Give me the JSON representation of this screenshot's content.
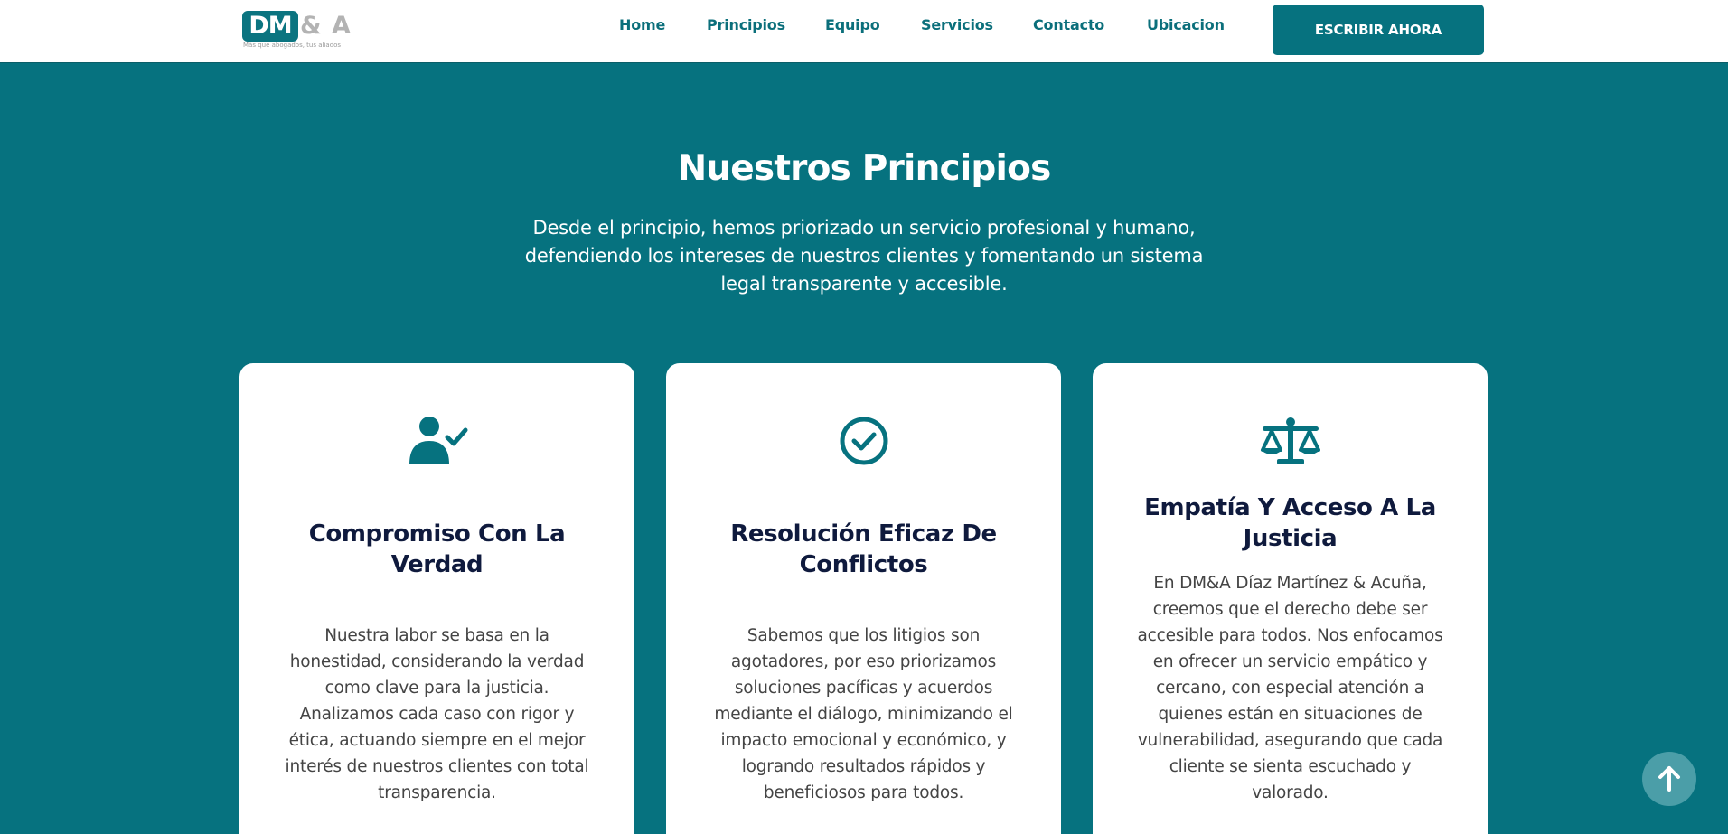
{
  "header": {
    "logo": {
      "mark": "DM",
      "amp": "& A",
      "tagline": "Más que abogados, tus aliados"
    },
    "nav": [
      "Home",
      "Principios",
      "Equipo",
      "Servicios",
      "Contacto",
      "Ubicacion"
    ],
    "cta_label": "ESCRIBIR AHORA"
  },
  "section": {
    "title": "Nuestros Principios",
    "intro": "Desde el principio, hemos priorizado un servicio profesional y humano, defendiendo los intereses de nuestros clientes y fomentando un sistema legal transparente y accesible."
  },
  "cards": [
    {
      "icon": "user-check-icon",
      "title": "Compromiso Con La Verdad",
      "text": "Nuestra labor se basa en la honestidad, considerando la verdad como clave para la justicia. Analizamos cada caso con rigor y ética, actuando siempre en el mejor interés de nuestros clientes con total transparencia."
    },
    {
      "icon": "check-circle-icon",
      "title": "Resolución Eficaz De Conflictos",
      "text": "Sabemos que los litigios son agotadores, por eso priorizamos soluciones pacíficas y acuerdos mediante el diálogo, minimizando el impacto emocional y económico, y logrando resultados rápidos y beneficiosos para todos."
    },
    {
      "icon": "scale-icon",
      "title": "Empatía Y Acceso A La Justicia",
      "text": "En DM&A Díaz Martínez & Acuña, creemos que el derecho debe ser accesible para todos. Nos enfocamos en ofrecer un servicio empático y cercano, con especial atención a quienes están en situaciones de vulnerabilidad, asegurando que cada cliente se sienta escuchado y valorado."
    }
  ],
  "colors": {
    "primary": "#06727f",
    "heading_dark": "#0f1a3d",
    "accent_text": "#0b6f7b"
  },
  "scroll_top_icon": "arrow-up-icon"
}
